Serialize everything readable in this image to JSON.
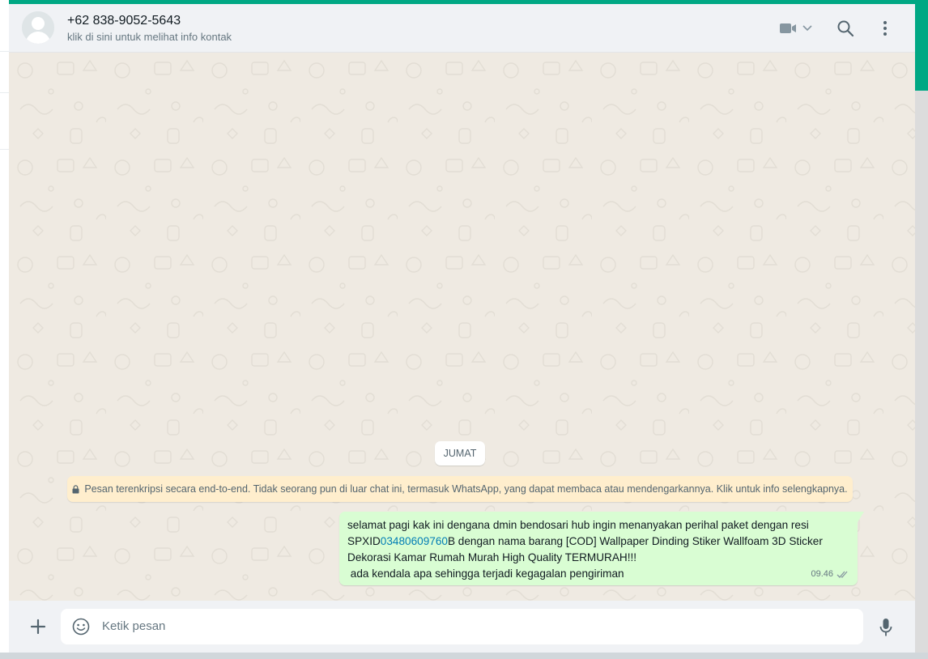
{
  "header": {
    "contact_name": "+62 838-9052-5643",
    "contact_subtitle": "klik di sini untuk melihat info kontak",
    "icons": [
      "video-call-icon",
      "chevron-down-icon",
      "search-icon",
      "menu-icon"
    ]
  },
  "conversation": {
    "day_label": "JUMAT",
    "encryption_notice": "Pesan terenkripsi secara end-to-end. Tidak seorang pun di luar chat ini, termasuk WhatsApp, yang dapat membaca atau mendengarkannya. Klik untuk info selengkapnya.",
    "message": {
      "line1": "selamat pagi kak ini dengana dmin bendosari hub ingin menanyakan perihal paket dengan resi",
      "line2_prefix": "SPXID",
      "line2_link": "03480609760",
      "line2_suffix": "B dengan nama barang [COD] Wallpaper Dinding Stiker Wallfoam 3D Sticker",
      "line3": "Dekorasi Kamar Rumah Murah High Quality TERMURAH!!!",
      "line4": " ada kendala apa sehingga terjadi kegagalan pengiriman",
      "time": "09.46",
      "status": "sent"
    }
  },
  "composer": {
    "placeholder": "Ketik pesan"
  },
  "colors": {
    "accent": "#00a884",
    "header_bg": "#f0f2f5",
    "chat_bg": "#efeae2",
    "outgoing_bubble": "#d9fdd3",
    "notice_bg": "#ffeecd",
    "link": "#027eb5"
  }
}
